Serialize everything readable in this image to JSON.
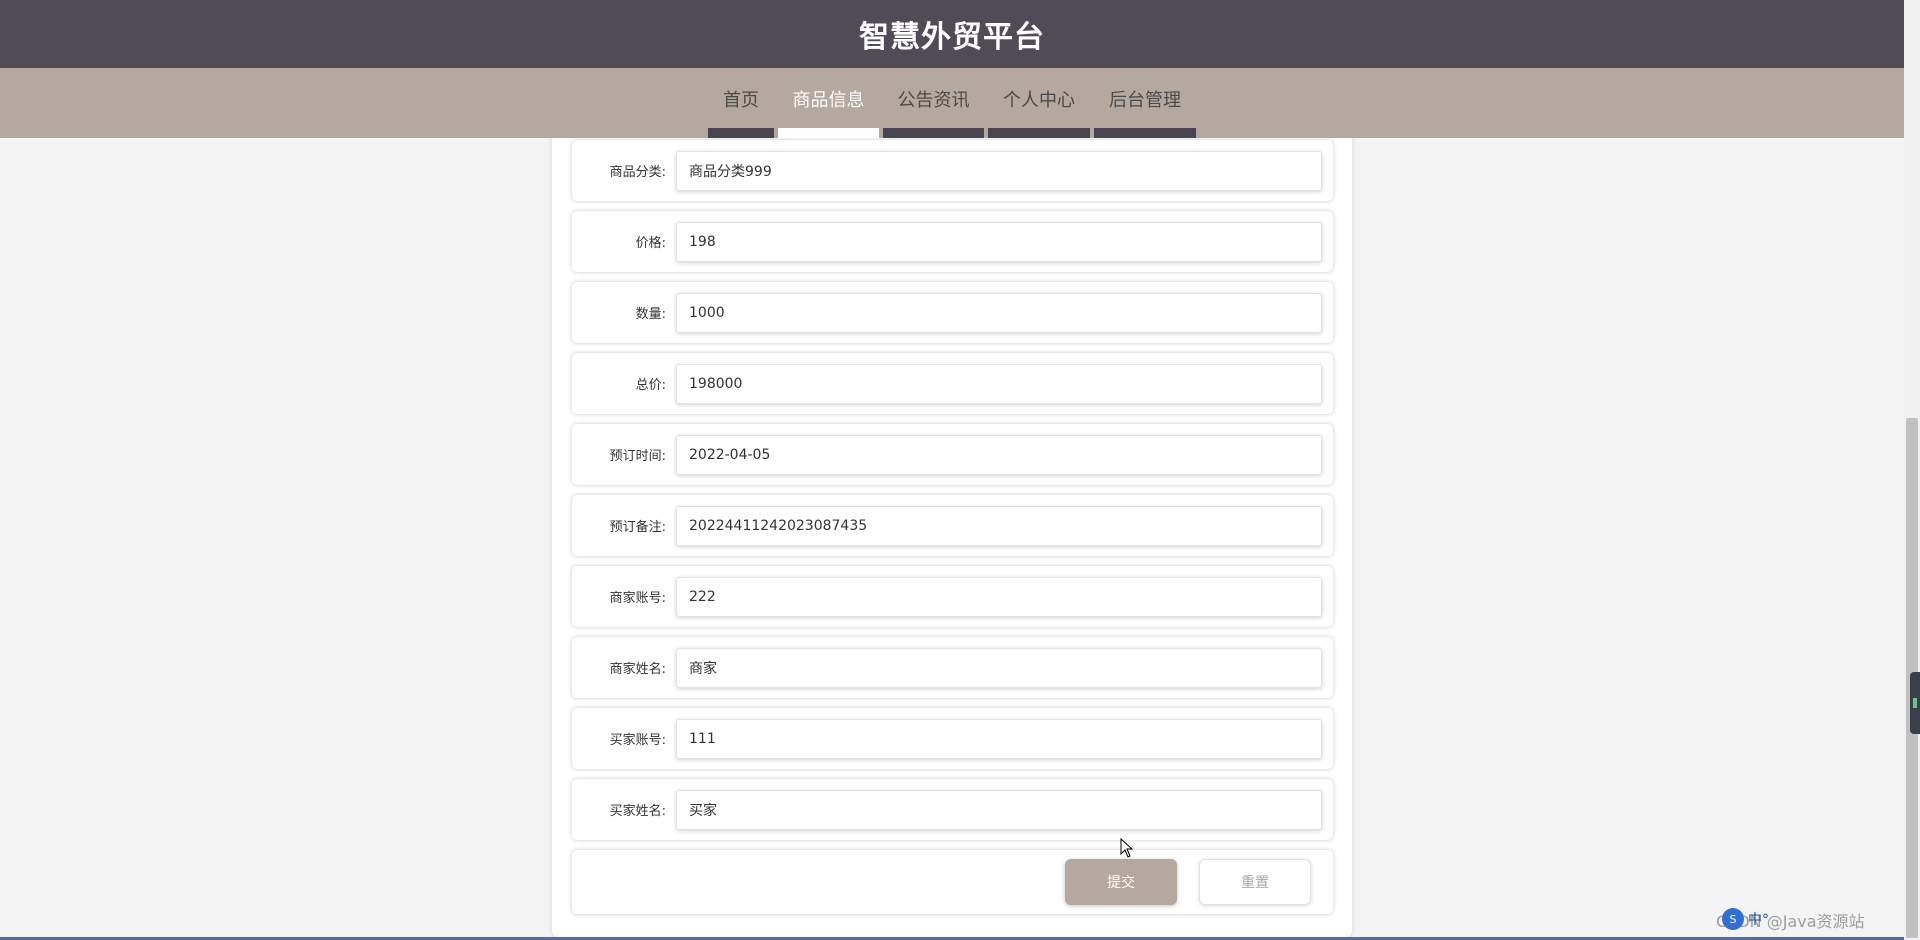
{
  "header": {
    "title": "智慧外贸平台"
  },
  "nav": {
    "items": [
      {
        "label": "首页",
        "active": false
      },
      {
        "label": "商品信息",
        "active": true
      },
      {
        "label": "公告资讯",
        "active": false
      },
      {
        "label": "个人中心",
        "active": false
      },
      {
        "label": "后台管理",
        "active": false
      }
    ]
  },
  "form": {
    "fields": [
      {
        "label": "商品分类:",
        "value": "商品分类999"
      },
      {
        "label": "价格:",
        "value": "198"
      },
      {
        "label": "数量:",
        "value": "1000"
      },
      {
        "label": "总价:",
        "value": "198000"
      },
      {
        "label": "预订时间:",
        "value": "2022-04-05"
      },
      {
        "label": "预订备注:",
        "value": "20224411242023087435"
      },
      {
        "label": "商家账号:",
        "value": "222"
      },
      {
        "label": "商家姓名:",
        "value": "商家"
      },
      {
        "label": "买家账号:",
        "value": "111"
      },
      {
        "label": "买家姓名:",
        "value": "买家"
      }
    ],
    "submit_label": "提交",
    "reset_label": "重置"
  },
  "overlay": {
    "ime_logo": "S",
    "ime_text": "中°",
    "watermark": "CSDN @Java资源站"
  },
  "colors": {
    "header_bg": "#514b58",
    "nav_bg": "#b5a89e",
    "accent": "#b5a89e"
  }
}
